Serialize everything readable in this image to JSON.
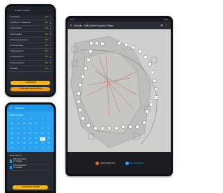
{
  "phone1": {
    "header_title": "1ª Pilha • Mandal",
    "rows": [
      {
        "label": "1.0 m Nódulo",
        "value": "GMT"
      },
      {
        "label": "1.1 Vistoria 10º Lançamento",
        "value": "GMT"
      },
      {
        "label": "1.2 Sem Nada 1",
        "value": "GMT"
      },
      {
        "label": "1.3 Sem Nada 2",
        "value": "GMT"
      },
      {
        "label": "1.4 Pega de Lançamento",
        "value": "GMT"
      },
      {
        "label": "1.5 Remate Metal",
        "value": "GMT"
      },
      {
        "label": "1.6 Revestimento 1",
        "value": "GMT"
      },
      {
        "label": "1.7 Revestimento 2",
        "value": "GMT"
      },
      {
        "label": "1.8 Revestimento 3",
        "value": "GMT"
      },
      {
        "label": "1.9 Selado",
        "value": "GMT"
      }
    ],
    "button_primary": "+ ADICIONAR",
    "button_secondary": "+ DUPLICAR NOVO PONTO"
  },
  "phone2": {
    "header_title": "Calendário",
    "calendar_month": "Dezembro 2018",
    "weekday_headers": [
      "S",
      "T",
      "Q",
      "Q",
      "S",
      "S",
      "D"
    ],
    "days": [
      "26",
      "27",
      "28",
      "29",
      "30",
      "1",
      "2",
      "3",
      "4",
      "5",
      "6",
      "7",
      "8",
      "9",
      "10",
      "11",
      "12",
      "13",
      "14",
      "15",
      "16",
      "17",
      "18",
      "19",
      "20",
      "21",
      "22",
      "23",
      "24",
      "25",
      "26",
      "27",
      "28",
      "29",
      "30",
      "31",
      "1",
      "2",
      "3",
      "4",
      "5",
      "6"
    ],
    "selected_day": "22",
    "events_title": "Dezembro 18",
    "events": [
      {
        "line1": "Arquitetura Fátima",
        "line2": "Ver Detalhes"
      },
      {
        "line1": "Pedro Loja Tijolos",
        "line2": "Ver Detalhes"
      }
    ],
    "button": "+ ADICIONAR EVENTO"
  },
  "tablet": {
    "status_time": "9:41",
    "status_right": "100%",
    "header_title": "Dominio - Sali (Urbest Dourado) / Mapa",
    "footer_buttons": [
      {
        "label": "CRIAR ARMAÇÃO",
        "color": "#e8731c"
      },
      {
        "label": "BLOCOS MAPA",
        "color": "#27a6f5"
      }
    ]
  },
  "colors": {
    "accent_yellow": "#f4b41a",
    "accent_blue": "#1e96e6",
    "dark_bg": "#262b33"
  }
}
